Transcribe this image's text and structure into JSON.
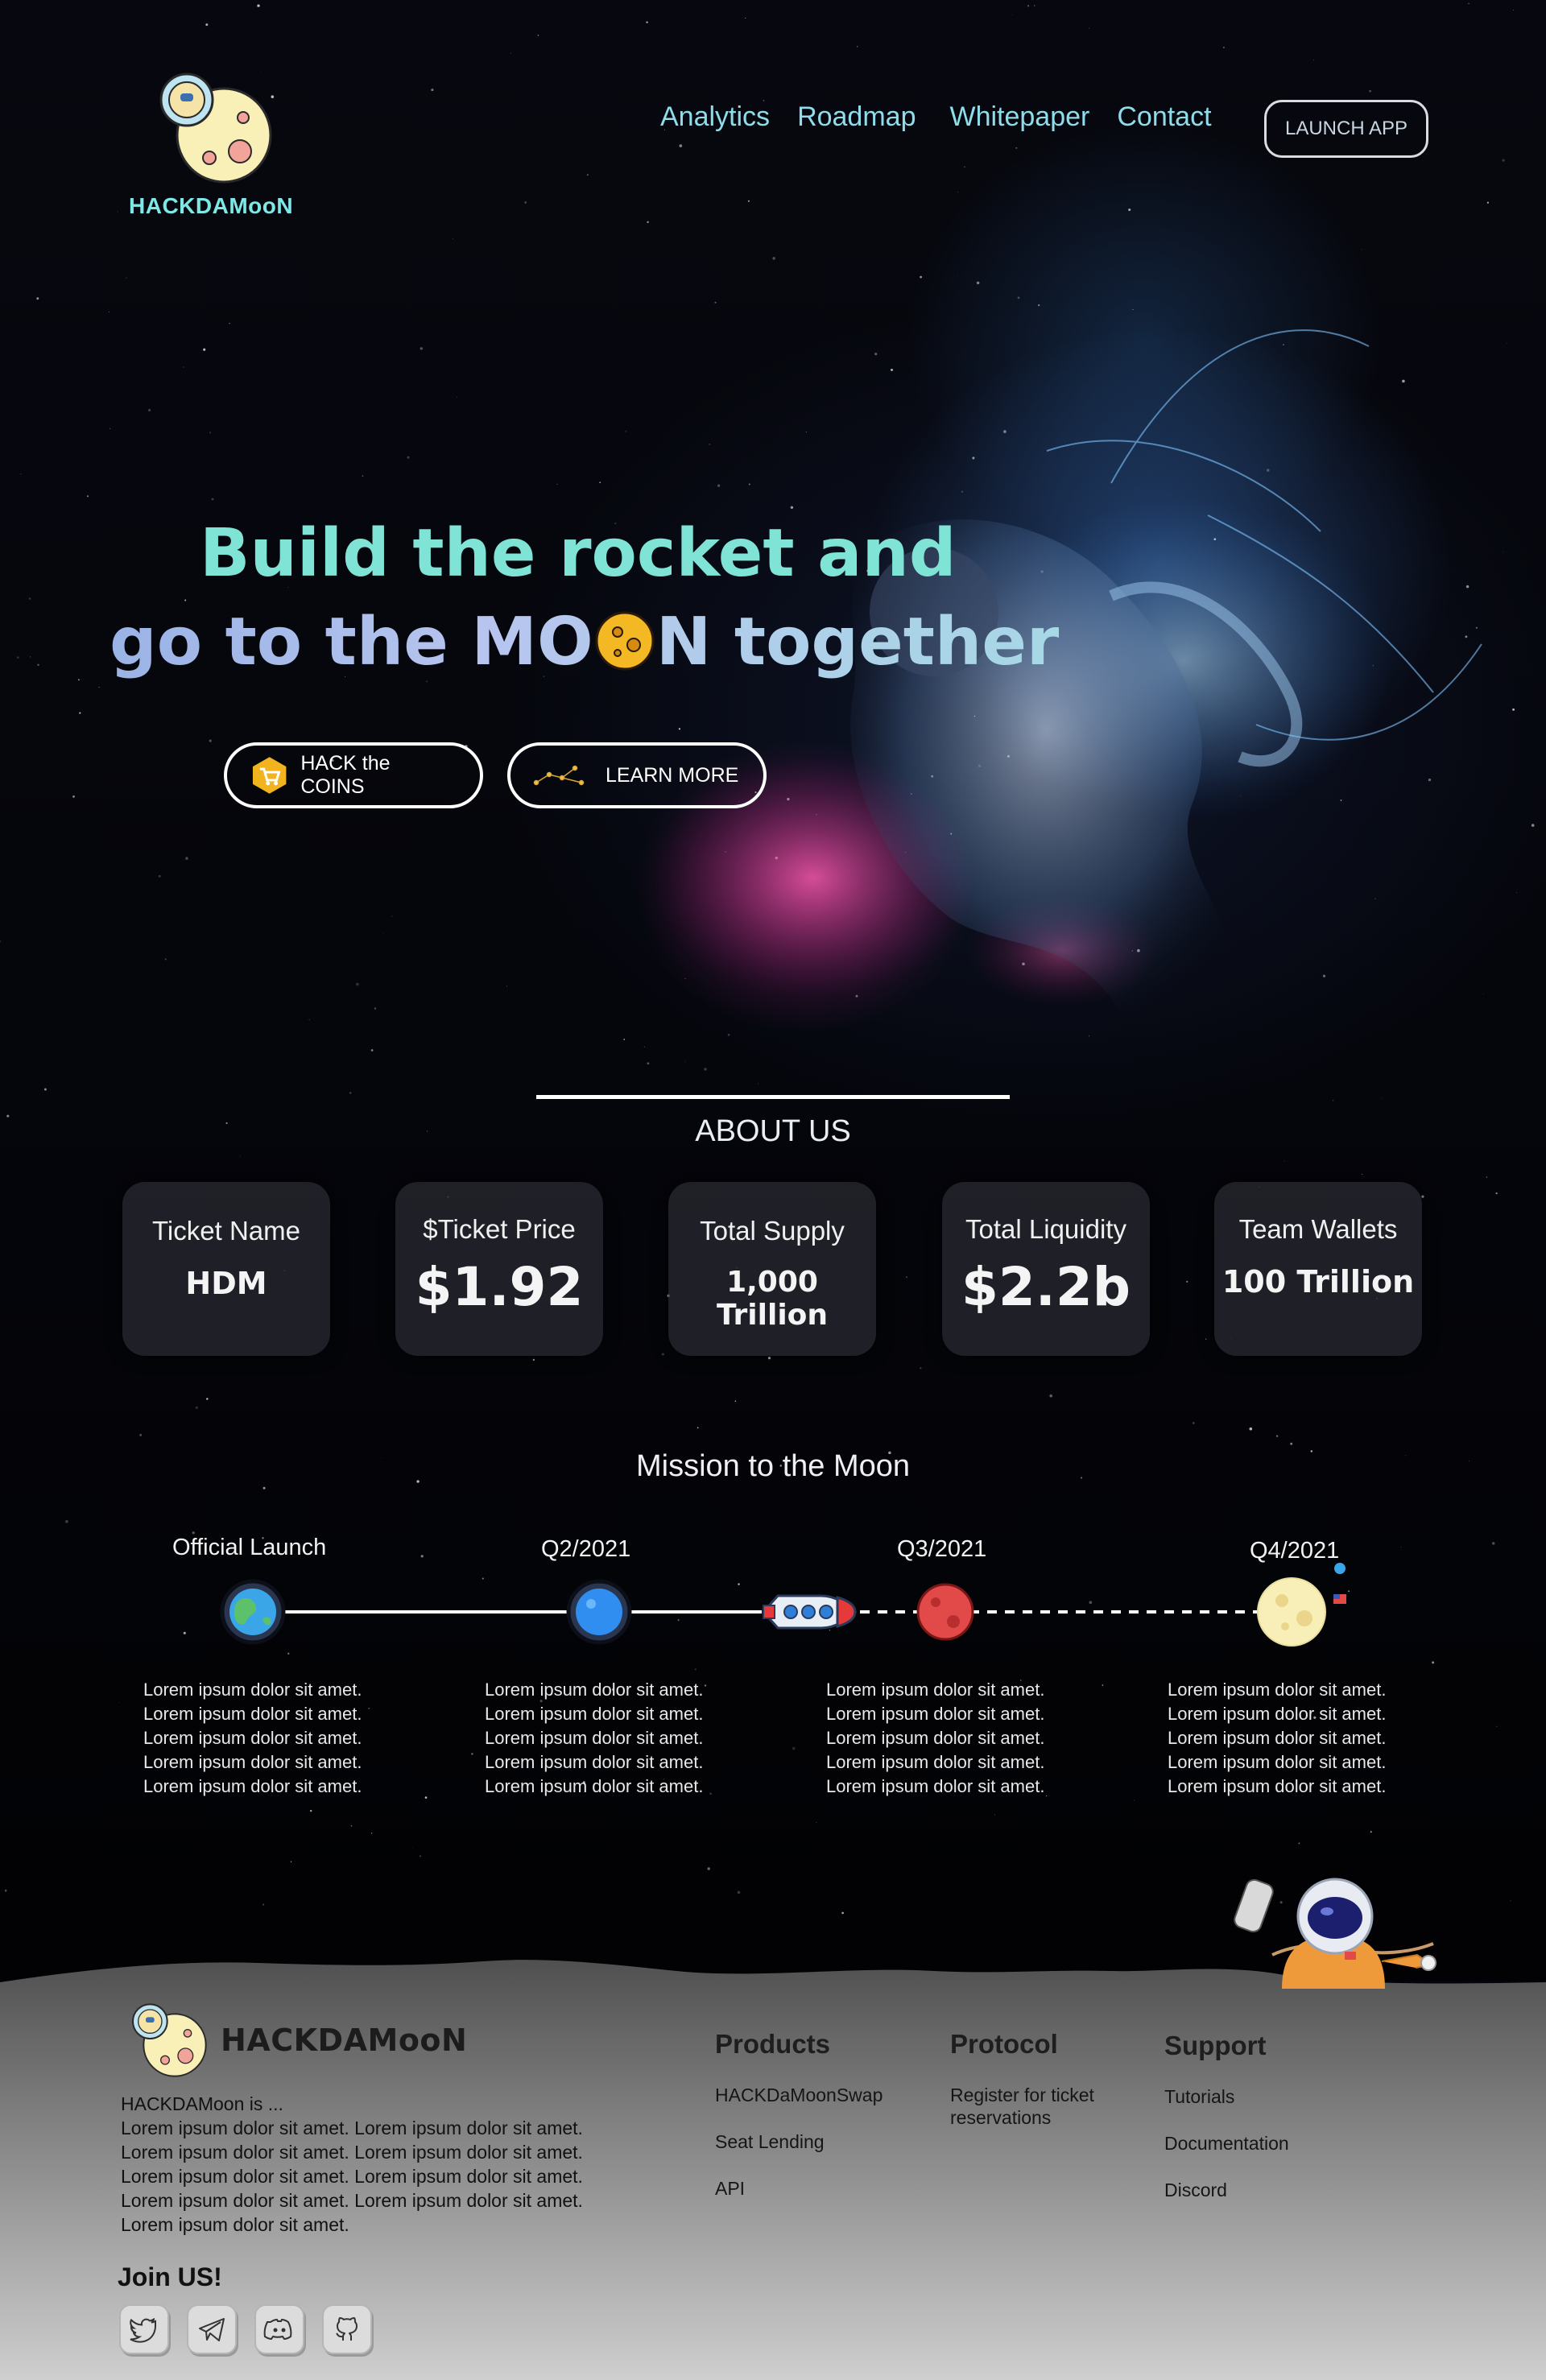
{
  "brand": {
    "name": "HACKDAMooN"
  },
  "nav": {
    "items": [
      "Analytics",
      "Roadmap",
      "Whitepaper",
      "Contact"
    ],
    "launch_label": "LAUNCH APP"
  },
  "hero": {
    "line1": "Build the rocket and",
    "line2_before": "go to the MO",
    "line2_after": "N together",
    "primary_button": "HACK the  COINS",
    "secondary_button": "LEARN MORE"
  },
  "about": {
    "title": "ABOUT US",
    "stats": [
      {
        "label": "Ticket Name",
        "value": "HDM"
      },
      {
        "label": "$Ticket Price",
        "value": "$1.92"
      },
      {
        "label": "Total Supply",
        "value": "1,000 Trillion"
      },
      {
        "label": "Total Liquidity",
        "value": "$2.2b"
      },
      {
        "label": "Team Wallets",
        "value": "100 Trillion"
      }
    ]
  },
  "roadmap": {
    "title": "Mission to the Moon",
    "milestones": [
      {
        "label": "Official Launch",
        "icon": "earth-icon",
        "lines": [
          "Lorem ipsum dolor sit amet.",
          "Lorem ipsum dolor sit amet.",
          "Lorem ipsum dolor sit amet.",
          "Lorem ipsum dolor sit amet.",
          "Lorem ipsum dolor sit amet."
        ]
      },
      {
        "label": "Q2/2021",
        "icon": "blue-planet-icon",
        "lines": [
          "Lorem ipsum dolor sit amet.",
          "Lorem ipsum dolor sit amet.",
          "Lorem ipsum dolor sit amet.",
          "Lorem ipsum dolor sit amet.",
          "Lorem ipsum dolor sit amet."
        ]
      },
      {
        "label": "Q3/2021",
        "icon": "mars-icon",
        "lines": [
          "Lorem ipsum dolor sit amet.",
          "Lorem ipsum dolor sit amet.",
          "Lorem ipsum dolor sit amet.",
          "Lorem ipsum dolor sit amet.",
          "Lorem ipsum dolor sit amet."
        ]
      },
      {
        "label": "Q4/2021",
        "icon": "moon-icon",
        "lines": [
          "Lorem ipsum dolor sit amet.",
          "Lorem ipsum dolor sit amet.",
          "Lorem ipsum dolor sit amet.",
          "Lorem ipsum dolor sit amet.",
          "Lorem ipsum dolor sit amet."
        ]
      }
    ]
  },
  "footer": {
    "brand": "HACKDAMooN",
    "description": [
      "HACKDAMoon is ...",
      "Lorem ipsum dolor sit amet. Lorem ipsum dolor sit amet.",
      "Lorem ipsum dolor sit amet. Lorem ipsum dolor sit amet.",
      "Lorem ipsum dolor sit amet. Lorem ipsum dolor sit amet.",
      "Lorem ipsum dolor sit amet. Lorem ipsum dolor sit amet.",
      "Lorem ipsum dolor sit amet."
    ],
    "columns": [
      {
        "title": "Products",
        "links": [
          "HACKDaMoonSwap",
          "Seat Lending",
          "API"
        ]
      },
      {
        "title": "Protocol",
        "links": [
          "Register for ticket\nreservations"
        ]
      },
      {
        "title": "Support",
        "links": [
          "Tutorials",
          "Documentation",
          "Discord"
        ]
      }
    ],
    "join_title": "Join US!",
    "socials": [
      "twitter-icon",
      "telegram-icon",
      "discord-icon",
      "github-icon"
    ]
  },
  "colors": {
    "accent_cyan": "#7ee8e6",
    "nav_link": "#8fdcea",
    "background": "#04040a",
    "footer_gray": "#9c9c9c"
  }
}
